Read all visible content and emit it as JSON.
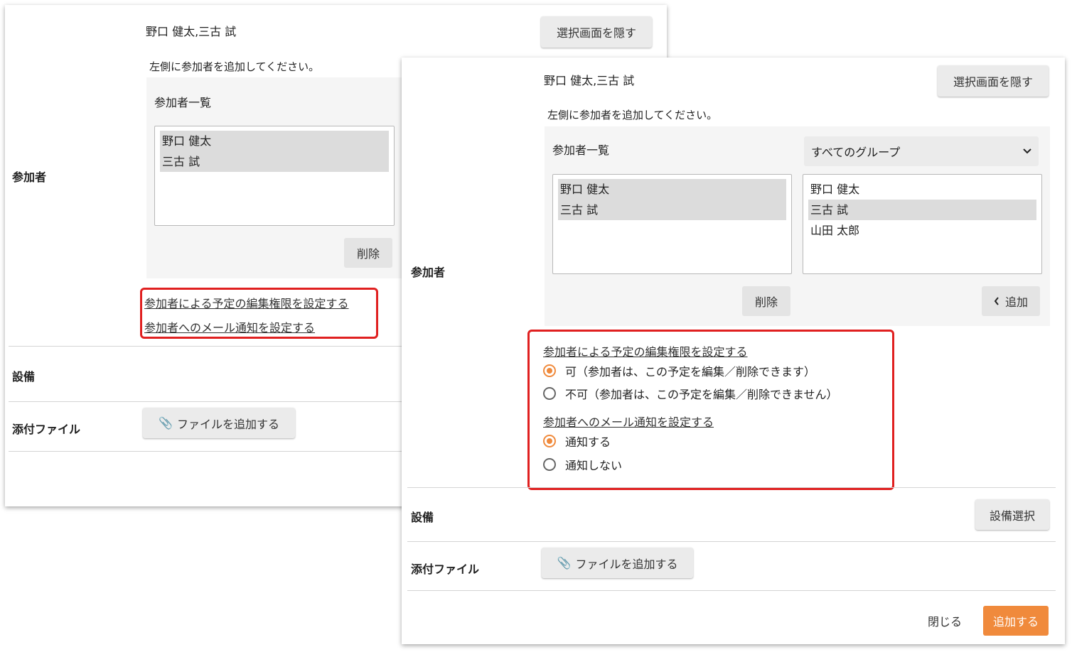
{
  "back": {
    "selected_names": "野口 健太,三古 試",
    "hide_button": "選択画面を隠す",
    "hint": "左側に参加者を追加してください。",
    "list_title": "参加者一覧",
    "participants": [
      "野口 健太",
      "三古 試"
    ],
    "delete_button": "削除",
    "participants_label": "参加者",
    "link_edit_permission": "参加者による予定の編集権限を設定する",
    "link_mail_notify": "参加者へのメール通知を設定する",
    "equipment_label": "設備",
    "attachment_label": "添付ファイル",
    "add_file_button": "ファイルを追加する"
  },
  "front": {
    "selected_names": "野口 健太,三古 試",
    "hide_button": "選択画面を隠す",
    "hint": "左側に参加者を追加してください。",
    "list_title": "参加者一覧",
    "group_select": "すべてのグループ",
    "participants": [
      "野口 健太",
      "三古 試"
    ],
    "candidates": [
      "野口 健太",
      "三古 試",
      "山田 太郎"
    ],
    "delete_button": "削除",
    "add_button": "追加",
    "participants_label": "参加者",
    "edit_permission_title": "参加者による予定の編集権限を設定する",
    "edit_allow": "可（参加者は、この予定を編集／削除できます）",
    "edit_deny": "不可（参加者は、この予定を編集／削除できません）",
    "mail_title": "参加者へのメール通知を設定する",
    "mail_on": "通知する",
    "mail_off": "通知しない",
    "equipment_label": "設備",
    "equipment_select_button": "設備選択",
    "attachment_label": "添付ファイル",
    "add_file_button": "ファイルを追加する",
    "close_button": "閉じる",
    "submit_button": "追加する"
  },
  "colors": {
    "accent": "#f08a3c",
    "highlight": "#e02020"
  },
  "icons": {
    "attach": "paperclip-icon",
    "chevron": "chevron-down-icon",
    "back": "chevron-left-icon"
  }
}
